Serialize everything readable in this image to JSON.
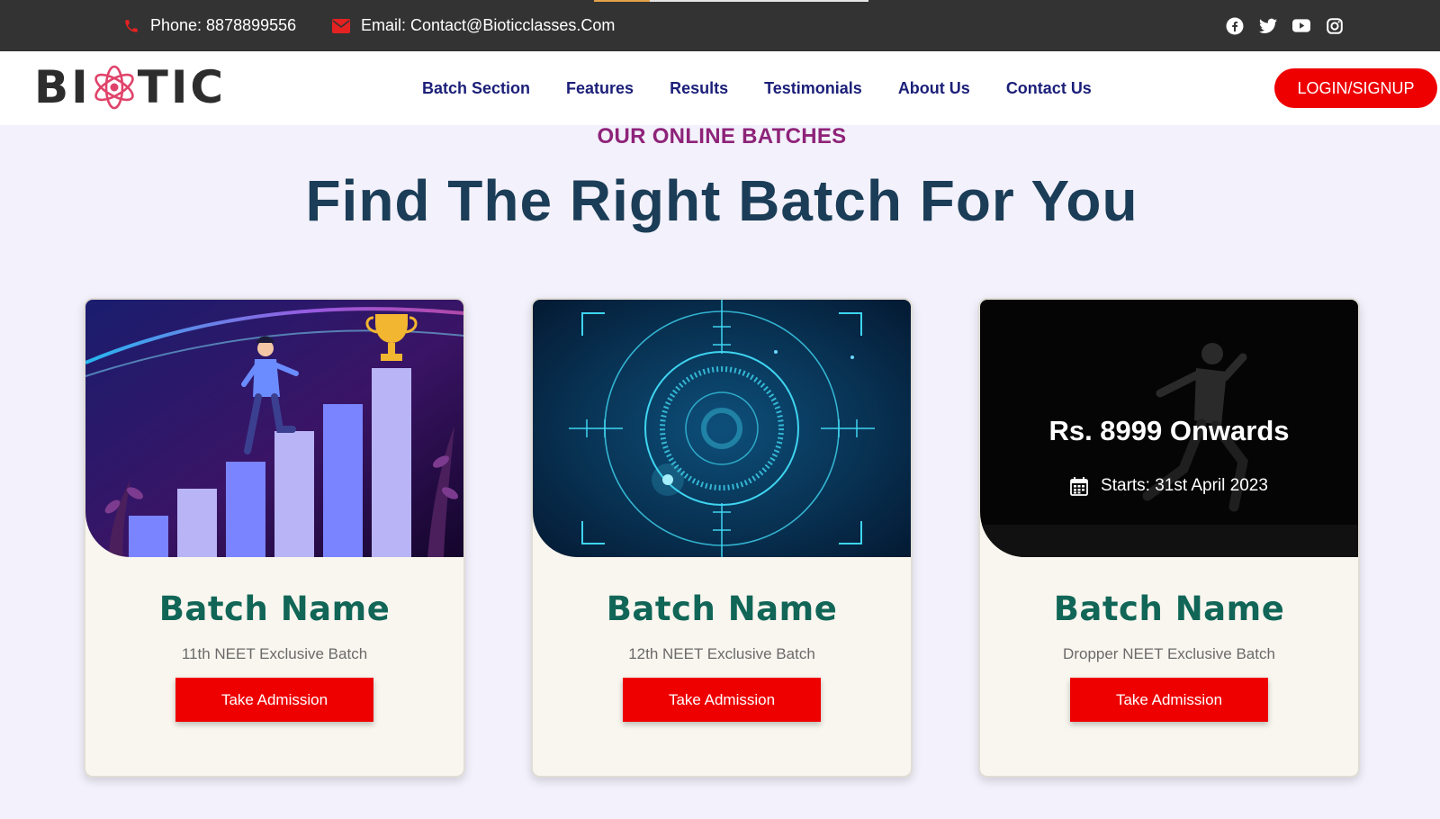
{
  "topbar": {
    "phone": "Phone: 8878899556",
    "email": "Email: Contact@Bioticclasses.Com",
    "social": [
      "facebook-icon",
      "twitter-icon",
      "youtube-icon",
      "instagram-icon"
    ]
  },
  "header": {
    "logo_left": "BI",
    "logo_right": "TIC",
    "nav": [
      "Batch Section",
      "Features",
      "Results",
      "Testimonials",
      "About Us",
      "Contact Us"
    ],
    "login_label": "LOGIN/SIGNUP"
  },
  "hero": {
    "eyebrow": "OUR ONLINE BATCHES",
    "title": "Find The Right Batch For You"
  },
  "cards": [
    {
      "title": "Batch Name",
      "subtitle": "11th NEET Exclusive Batch",
      "button": "Take Admission"
    },
    {
      "title": "Batch Name",
      "subtitle": "12th NEET Exclusive Batch",
      "button": "Take Admission"
    },
    {
      "title": "Batch Name",
      "subtitle": "Dropper NEET Exclusive Batch",
      "button": "Take Admission",
      "price": "Rs. 8999 Onwards",
      "start": "Starts: 31st April 2023"
    }
  ],
  "colors": {
    "accent_red": "#ee0000",
    "nav_text": "#1b1f78",
    "headline": "#1b3d57",
    "eyebrow": "#8e2379",
    "card_title": "#116657",
    "topbar_bg": "#333333"
  }
}
